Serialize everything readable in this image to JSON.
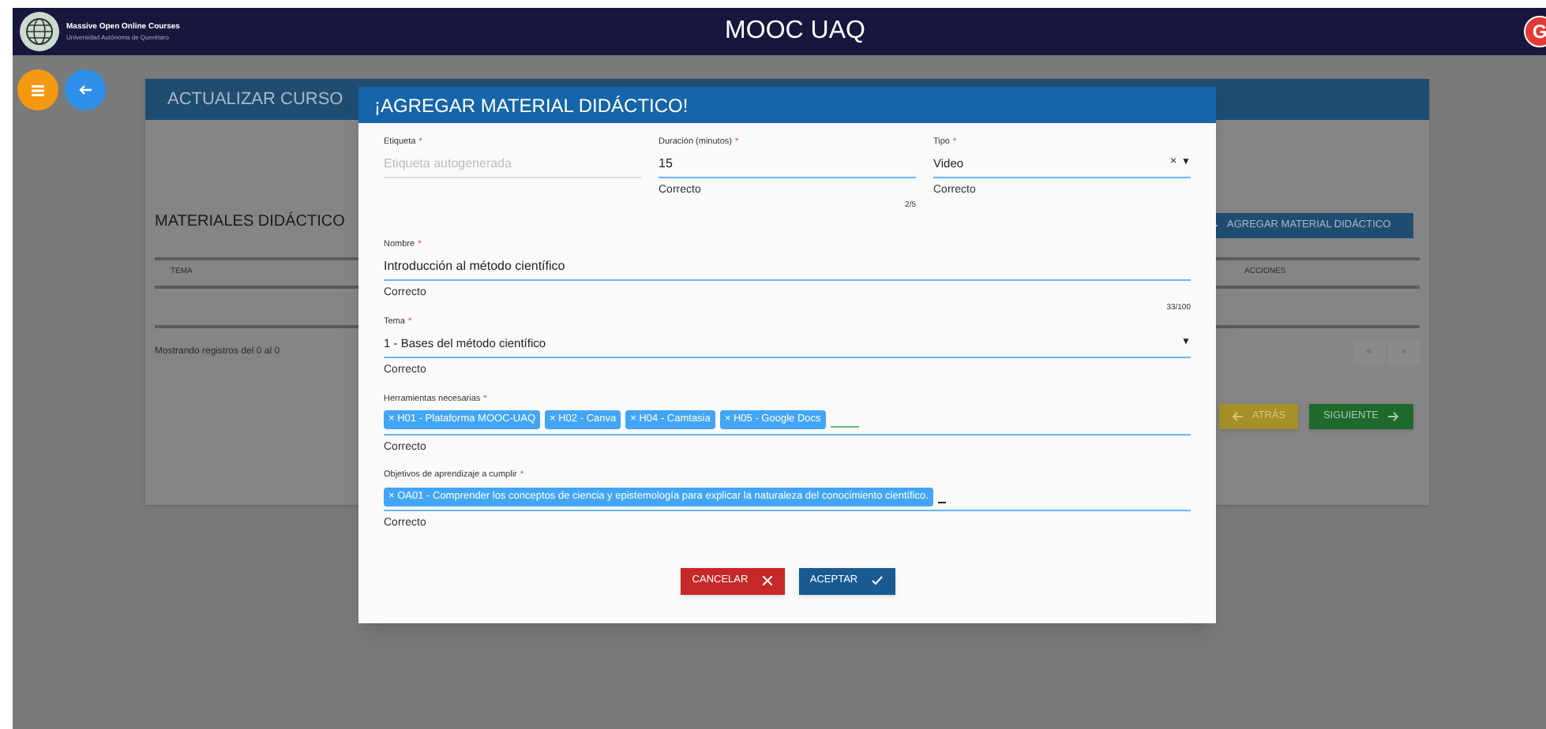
{
  "header": {
    "brand_title": "Massive Open Online Courses",
    "brand_subtitle": "Universidad Autónoma de Querétaro",
    "app_title": "MOOC UAQ",
    "avatar": "G"
  },
  "card": {
    "title": "ACTUALIZAR CURSO",
    "section_title": "MATERIALES DIDÁCTICO",
    "add_button": "AGREGAR MATERIAL DIDÁCTICO",
    "columns": [
      "TEMA",
      "ACCIONES"
    ],
    "footer": "Mostrando registros del 0 al 0",
    "pagination": [
      "«",
      "»"
    ],
    "back_button": "ATRÁS",
    "next_button": "SIGUIENTE"
  },
  "modal": {
    "title": "¡AGREGAR MATERIAL DIDÁCTICO!",
    "row": [
      {
        "kind": "text",
        "label": "Etiqueta",
        "mark": "*",
        "placeholder": "Etiqueta autogenerada",
        "focused": false
      },
      {
        "kind": "text",
        "label": "Duración (minutos)",
        "mark": "*",
        "value": "15",
        "focused": true,
        "helper": "Correcto",
        "counter": "2/5"
      },
      {
        "kind": "select",
        "label": "Tipo",
        "mark": "*",
        "value": "Video",
        "clear": "×",
        "arrow": "▼",
        "focused": true,
        "helper": "Correcto"
      }
    ],
    "fields": [
      {
        "kind": "text",
        "label": "Nombre",
        "mark": "*",
        "value": "Introducción al método científico",
        "focused": true,
        "helper": "Correcto",
        "counter": "33/100"
      },
      {
        "kind": "select",
        "label": "Tema",
        "mark": "*",
        "value": "1 - Bases del método científico",
        "arrow": "▼",
        "focused": true,
        "helper": "Correcto"
      },
      {
        "kind": "chips",
        "label": "Herramientas necesarias",
        "mark": "*",
        "chips": [
          "× H01 - Plataforma MOOC-UAQ",
          "× H02 - Canva",
          "× H04 - Camtasia",
          "× H05 - Google Docs"
        ],
        "focused": true,
        "active": true,
        "helper": "Correcto"
      },
      {
        "kind": "chips",
        "label": "Objetivos de aprendizaje a cumplir",
        "mark": "*",
        "chips": [
          "× OA01 - Comprender los conceptos de ciencia y epistemología para explicar la naturaleza del conocimiento científico."
        ],
        "focused": true,
        "active": false,
        "helper": "Correcto"
      }
    ],
    "cancel_button": "CANCELAR",
    "accept_button": "ACEPTAR"
  }
}
